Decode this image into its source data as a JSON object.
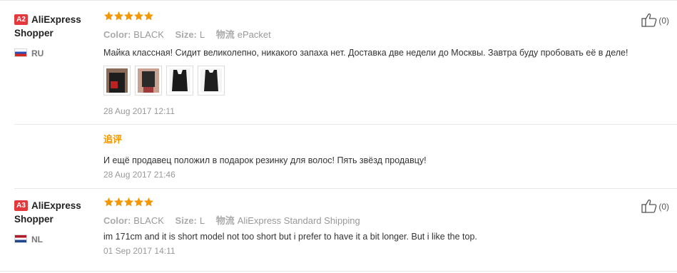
{
  "reviews": [
    {
      "level_badge": "A2",
      "user_name": "AliExpress Shopper",
      "country_code": "RU",
      "rating": 5,
      "props": [
        {
          "key": "Color:",
          "value": "BLACK"
        },
        {
          "key": "Size:",
          "value": "L"
        },
        {
          "key": "物流",
          "value": "ePacket"
        }
      ],
      "text": "Майка классная! Сидит великолепно, никакого запаха нет. Доставка две недели до Москвы. Завтра буду пробовать её в деле!",
      "photos": [
        "photo-1",
        "photo-2",
        "photo-3",
        "photo-4"
      ],
      "date": "28 Aug 2017 12:11",
      "additional": {
        "label": "追评",
        "text": "И ещё продавец положил в подарок резинку для волос! Пять звёзд продавцу!",
        "date": "28 Aug 2017 21:46"
      },
      "likes": "(0)"
    },
    {
      "level_badge": "A3",
      "user_name": "AliExpress Shopper",
      "country_code": "NL",
      "rating": 5,
      "props": [
        {
          "key": "Color:",
          "value": "BLACK"
        },
        {
          "key": "Size:",
          "value": "L"
        },
        {
          "key": "物流",
          "value": "AliExpress Standard Shipping"
        }
      ],
      "text": "im 171cm and it is short model not too short but i prefer to have it a bit longer. But i like the top.",
      "date": "01 Sep 2017 14:11",
      "likes": "(0)"
    }
  ],
  "colors": {
    "star": "#f39800",
    "level_badge": "#e4393c",
    "additional_label": "#f39800",
    "divider": "#e8e8e8"
  },
  "icons": {
    "like": "thumbs-up-icon",
    "star": "star-icon",
    "flag_ru": "russia-flag-icon",
    "flag_nl": "netherlands-flag-icon"
  }
}
